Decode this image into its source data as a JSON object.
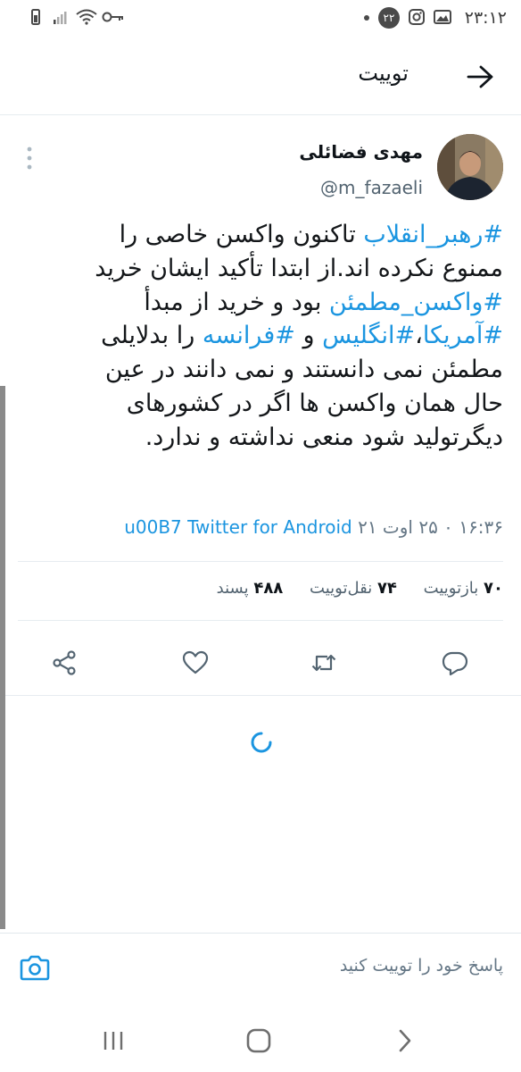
{
  "status_bar": {
    "time": "۲۳:۱۲",
    "notification_count": "۲۲"
  },
  "header": {
    "title": "توییت"
  },
  "tweet": {
    "author_name": "مهدی فضائلی",
    "author_handle": "@m_fazaeli",
    "lines": [
      [
        {
          "t": "#رهبر_انقلاب",
          "tag": true
        },
        {
          "t": " تاکنون واکسن خاصی را",
          "tag": false
        }
      ],
      [
        {
          "t": "ممنوع نکرده اند.از ابتدا تأکید ایشان خرید",
          "tag": false
        }
      ],
      [
        {
          "t": "#واکسن_مطمئن",
          "tag": true
        },
        {
          "t": " بود و خرید از مبدأ",
          "tag": false
        }
      ],
      [
        {
          "t": "#آمریکا",
          "tag": true
        },
        {
          "t": "،",
          "tag": false
        },
        {
          "t": "#انگلیس",
          "tag": true
        },
        {
          "t": " و ",
          "tag": false
        },
        {
          "t": "#فرانسه",
          "tag": true
        },
        {
          "t": " را بدلایلی",
          "tag": false
        }
      ],
      [
        {
          "t": "مطمئن نمی دانستند و نمی دانند در عین",
          "tag": false
        }
      ],
      [
        {
          "t": "حال همان واکسن ها اگر در کشورهای",
          "tag": false
        }
      ],
      [
        {
          "t": "دیگرتولید شود منعی نداشته و ندارد.",
          "tag": false
        }
      ]
    ],
    "timestamp": "۱۶:۳۶ ۰ ۲۵ اوت ۲۱",
    "source_separator": "u00B7",
    "source": "Twitter for Android"
  },
  "stats": {
    "quote_tweets_count": "۷۰",
    "quote_tweets_label": "بازتوییت",
    "retweets_count": "۷۴",
    "retweets_label": "نقل‌توییت",
    "likes_count": "۴۸۸",
    "likes_label": "پسند"
  },
  "reply": {
    "placeholder": "پاسخ خود را توییت کنید"
  },
  "colors": {
    "link": "#1b95e0",
    "muted": "#657786",
    "divider": "#e6ecf0"
  },
  "icons": [
    "wifi-icon",
    "key-icon",
    "signal-icon",
    "instagram-icon",
    "image-icon",
    "back-arrow-icon",
    "more-icon",
    "share-icon",
    "like-icon",
    "retweet-icon",
    "reply-icon",
    "loading-spinner-icon",
    "camera-icon",
    "recent-apps-icon",
    "home-icon",
    "back-icon"
  ]
}
